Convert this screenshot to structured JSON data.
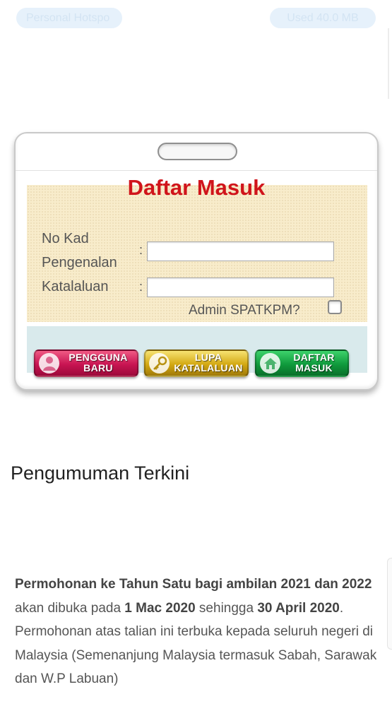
{
  "status_bar": {
    "hotspot_label": "Personal Hotspo",
    "usage_label": "Used  40.0 MB"
  },
  "login_card": {
    "title": "Daftar Masuk",
    "ic_label_line1": "No Kad",
    "ic_label_line2": "Pengenalan",
    "password_label": "Katalaluan",
    "colon": ":",
    "ic_value": "",
    "password_value": "",
    "admin_label": "Admin SPATKPM?",
    "admin_checked": false,
    "buttons": {
      "new_user_line1": "PENGGUNA",
      "new_user_line2": "BARU",
      "forgot_line1": "LUPA",
      "forgot_line2": "KATALALUAN",
      "login_line1": "DAFTAR",
      "login_line2": "MASUK"
    }
  },
  "announcement": {
    "heading": "Pengumuman Terkini",
    "bold_intro": "Permohonan ke Tahun Satu bagi ambilan 2021 dan 2022",
    "text_1": " akan dibuka pada ",
    "date_start": "1 Mac 2020",
    "text_2": " sehingga ",
    "date_end": "30 April 2020",
    "text_3": ". Permohonan atas talian ini terbuka kepada seluruh negeri di Malaysia (Semenanjung Malaysia termasuk Sabah, Sarawak dan W.P Labuan)"
  },
  "colors": {
    "title_red": "#d0141b",
    "new_user_button": "#c81452",
    "forgot_button": "#d3a812",
    "login_button": "#0f9a3c",
    "form_panel": "#f8eccb",
    "button_bar": "#d9eaec"
  }
}
